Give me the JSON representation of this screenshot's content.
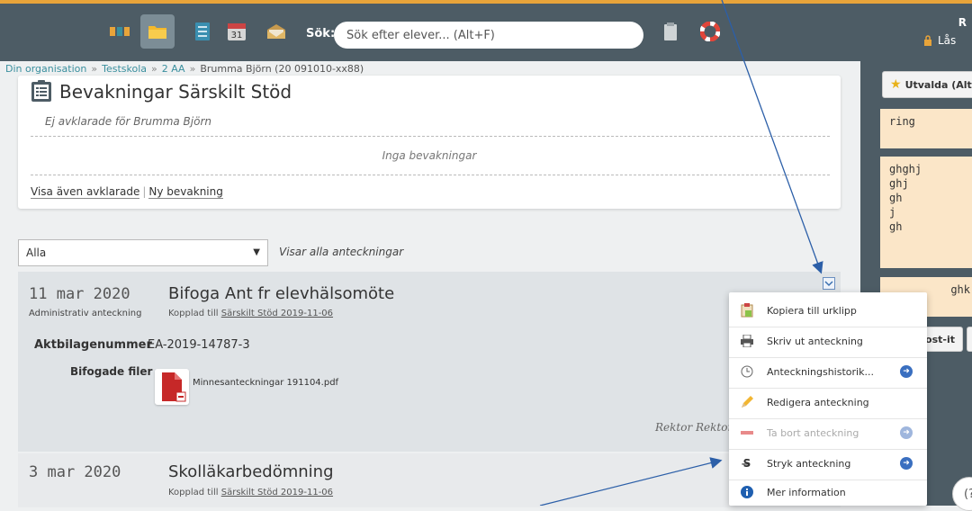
{
  "topbar": {
    "search_label": "Sök:",
    "search_placeholder": "Sök efter elever... (Alt+F)",
    "user_initial": "R",
    "lock_label": "Lås",
    "calendar_day": "31"
  },
  "breadcrumb": {
    "items": [
      "Din organisation",
      "Testskola",
      "2 AA",
      "Brumma Björn (20 091010-xx88)"
    ],
    "separator": "»"
  },
  "bevakningar": {
    "title": "Bevakningar Särskilt Stöd",
    "subtitle": "Ej avklarade för Brumma Björn",
    "empty_text": "Inga bevakningar",
    "link_show_done": "Visa även avklarade",
    "link_new": "Ny bevakning"
  },
  "filter": {
    "selected": "Alla",
    "info": "Visar alla anteckningar"
  },
  "notes": [
    {
      "date": "11 mar 2020",
      "type": "Administrativ anteckning",
      "title": "Bifoga Ant fr elevhälsomöte",
      "linked_prefix": "Kopplad till",
      "linked_target": "Särskilt Stöd 2019-11-06",
      "attachment_number_label": "Aktbilagenummer",
      "attachment_number_value": "EA-2019-14787-3",
      "files_label": "Bifogade filer",
      "file_name": "Minnesanteckningar 191104.pdf",
      "signature": "Rektor Rektor"
    },
    {
      "date": "3 mar 2020",
      "title": "Skolläkarbedömning",
      "linked_prefix": "Kopplad till",
      "linked_target": "Särskilt Stöd 2019-11-06"
    }
  ],
  "context_menu": {
    "items": [
      {
        "label": "Kopiera till urklipp",
        "icon": "clipboard-icon",
        "submenu": false,
        "disabled": false
      },
      {
        "label": "Skriv ut anteckning",
        "icon": "printer-icon",
        "submenu": false,
        "disabled": false
      },
      {
        "label": "Anteckningshistorik...",
        "icon": "clock-icon",
        "submenu": true,
        "disabled": false
      },
      {
        "label": "Redigera anteckning",
        "icon": "pencil-icon",
        "submenu": false,
        "disabled": false
      },
      {
        "label": "Ta bort anteckning",
        "icon": "minus-icon",
        "submenu": true,
        "disabled": true
      },
      {
        "label": "Stryk anteckning",
        "icon": "strikethrough-icon",
        "submenu": true,
        "disabled": false
      },
      {
        "label": "Mer information",
        "icon": "info-icon",
        "submenu": false,
        "disabled": false
      }
    ]
  },
  "right_panel": {
    "utvalda_label": "Utvalda (Alt+",
    "postits": [
      "ring",
      "ghghj\nghj\ngh\nj\ngh",
      "ghk"
    ],
    "postit_button": "ost-it",
    "help_label": "(?"
  },
  "colors": {
    "topbar": "#4d5c65",
    "accent": "#e8a43a",
    "link": "#3a8f9e",
    "postit": "#fbe6c8",
    "menu_arrow": "#3a6fc0"
  }
}
